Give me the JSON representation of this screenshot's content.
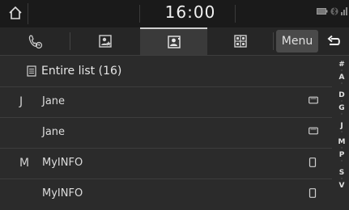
{
  "status": {
    "time": "16:00"
  },
  "tabs": [
    {
      "name": "tab-recent-calls",
      "icon": "call-log-icon",
      "active": false
    },
    {
      "name": "tab-favourites",
      "icon": "favourites-icon",
      "active": false
    },
    {
      "name": "tab-contacts",
      "icon": "contacts-icon",
      "active": true
    },
    {
      "name": "tab-keypad",
      "icon": "keypad-icon",
      "active": false
    }
  ],
  "toolbar": {
    "menu_label": "Menu"
  },
  "list": {
    "header": "Entire list (16)",
    "rows": [
      {
        "letter": "J",
        "name": "Jane",
        "device": "tablet-icon"
      },
      {
        "letter": "",
        "name": "Jane",
        "device": "tablet-icon"
      },
      {
        "letter": "M",
        "name": "MyINFO",
        "device": "phone-icon"
      },
      {
        "letter": "",
        "name": "MyINFO",
        "device": "phone-icon"
      }
    ]
  },
  "alpha_index": [
    "#",
    "A",
    "D",
    "G",
    "J",
    "M",
    "P",
    "S",
    "V"
  ],
  "colors": {
    "background": "#2b2b2b",
    "statusbar": "#1a1a1a",
    "divider": "#3d3d3d",
    "text": "#dcdcdc"
  }
}
